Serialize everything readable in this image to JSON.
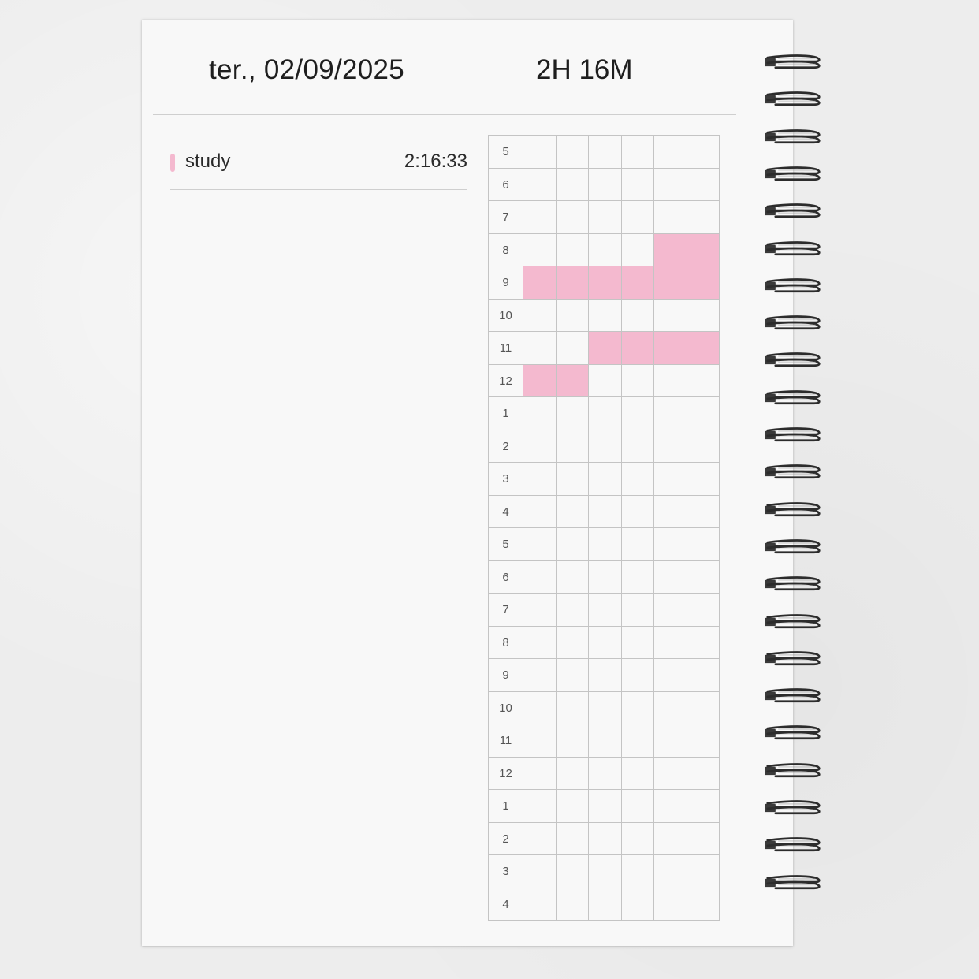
{
  "header": {
    "date": "ter., 02/09/2025",
    "total_time": "2H 16M"
  },
  "tasks": [
    {
      "name": "study",
      "duration": "2:16:33",
      "color": "#f4b9cf"
    }
  ],
  "timeline": {
    "hours": [
      "5",
      "6",
      "7",
      "8",
      "9",
      "10",
      "11",
      "12",
      "1",
      "2",
      "3",
      "4",
      "5",
      "6",
      "7",
      "8",
      "9",
      "10",
      "11",
      "12",
      "1",
      "2",
      "3",
      "4"
    ],
    "segments_per_hour": 6,
    "filled_color": "#f4b9cf",
    "filled": [
      {
        "hour_index": 3,
        "segments": [
          4,
          5
        ]
      },
      {
        "hour_index": 4,
        "segments": [
          0,
          1,
          2,
          3,
          4,
          5
        ]
      },
      {
        "hour_index": 6,
        "segments": [
          2,
          3,
          4,
          5
        ]
      },
      {
        "hour_index": 7,
        "segments": [
          0,
          1
        ]
      }
    ]
  },
  "colors": {
    "grid_line": "#c4c4c4",
    "accent": "#f4b9cf",
    "text": "#1e1e1e"
  }
}
